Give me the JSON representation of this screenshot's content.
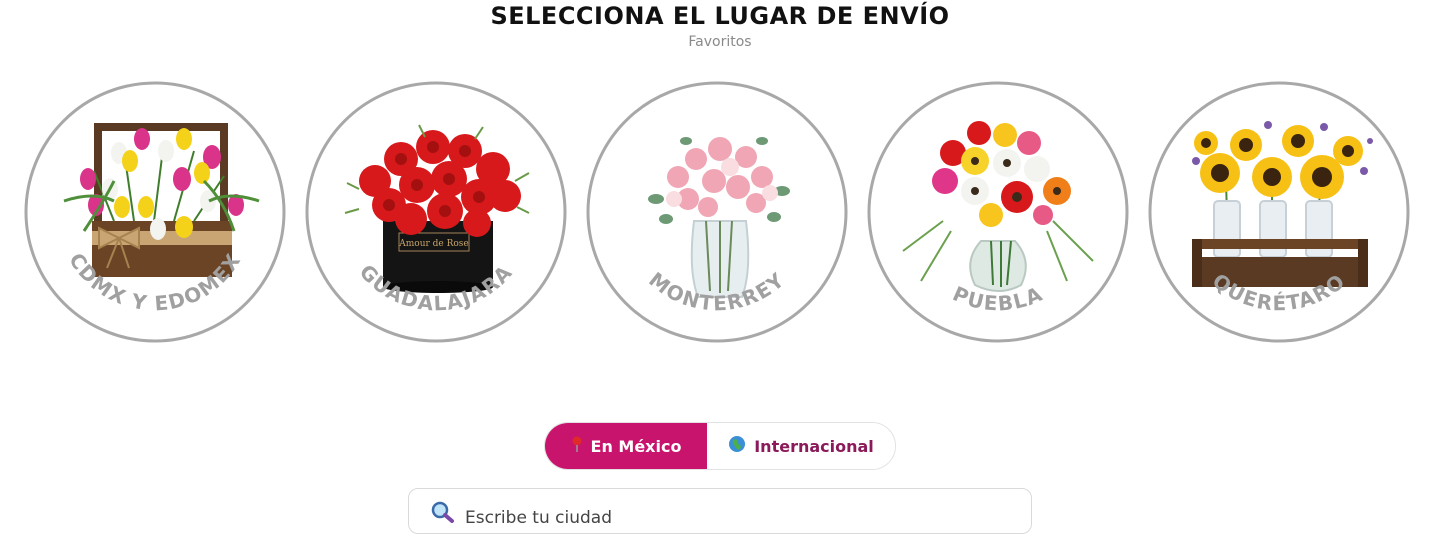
{
  "header": {
    "title": "SELECCIONA EL LUGAR DE ENVÍO",
    "subtitle": "Favoritos"
  },
  "favorites": [
    {
      "label": "CDMX Y EDOMEX",
      "image": "tulips-in-wooden-box"
    },
    {
      "label": "GUADALAJARA",
      "image": "red-roses-in-black-hatbox"
    },
    {
      "label": "MONTERREY",
      "image": "pink-bouquet-in-glass-vase"
    },
    {
      "label": "PUEBLA",
      "image": "gerbera-bouquet-in-glass-vase"
    },
    {
      "label": "QUERÉTARO",
      "image": "sunflowers-in-wooden-crate"
    }
  ],
  "hatbox_label": "Amour de Rose",
  "tabs": {
    "mexico": {
      "label": "En México",
      "icon": "pin-icon"
    },
    "international": {
      "label": "Internacional",
      "icon": "globe-icon"
    }
  },
  "search": {
    "placeholder": "Escribe tu ciudad",
    "icon": "search-icon"
  },
  "colors": {
    "accent": "#c8146c",
    "accent_text": "#8b1a5a",
    "circle_border": "#a8a8a8",
    "label_gray": "#a0a0a0"
  }
}
